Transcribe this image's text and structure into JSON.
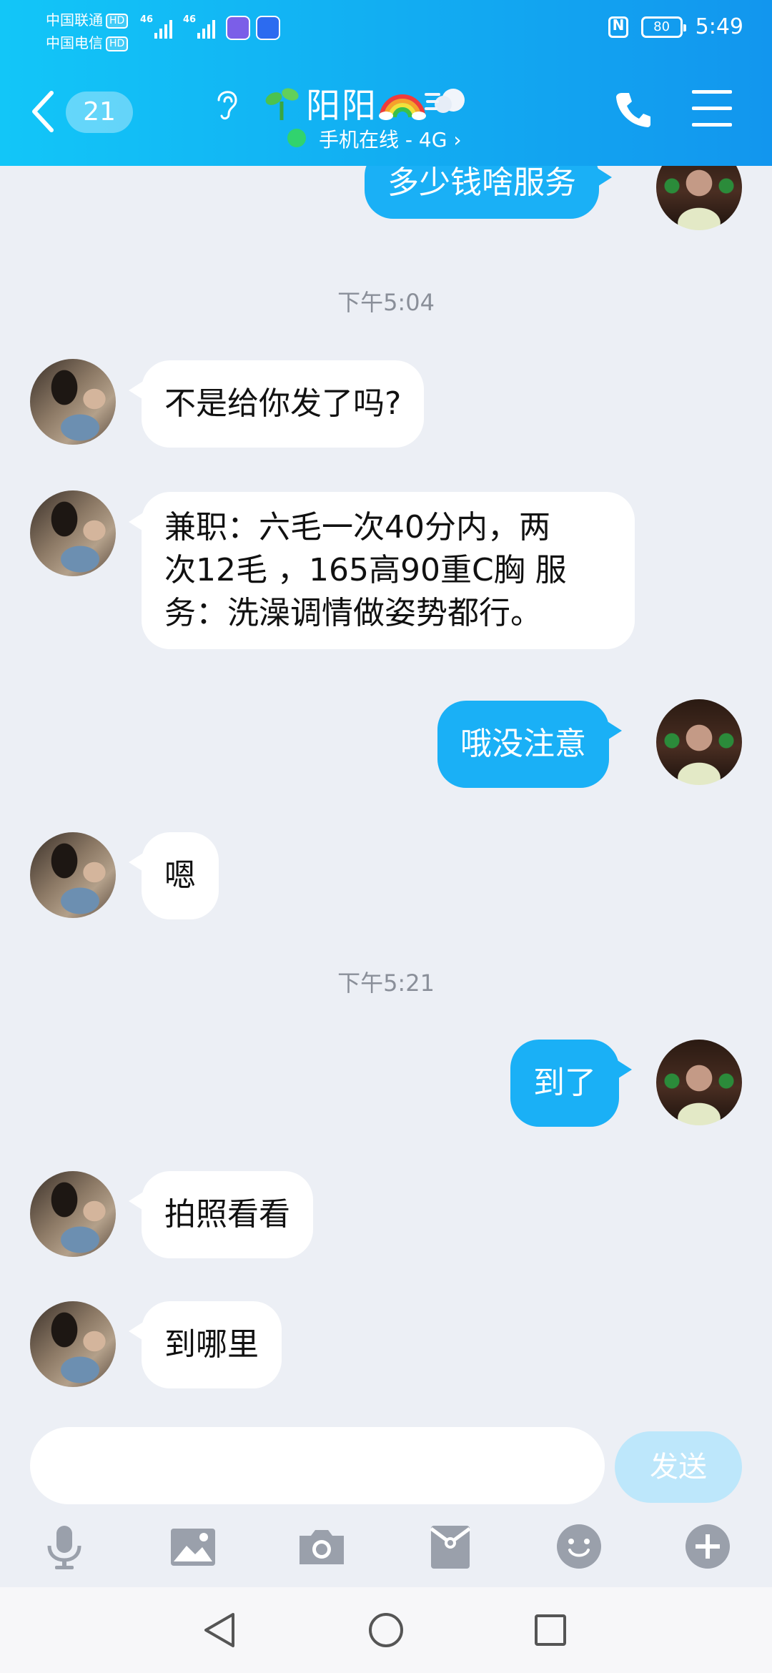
{
  "status_bar": {
    "carrier1": "中国联通",
    "carrier2": "中国电信",
    "hd": "HD",
    "network1": "46",
    "network2": "46",
    "battery": "80",
    "time": "5:49"
  },
  "header": {
    "unread_count": "21",
    "contact_name": "阳阳",
    "status": "手机在线 - 4G",
    "status_chevron": "›",
    "colors": {
      "gradient_start": "#12c6f8",
      "gradient_end": "#1296ee",
      "online_dot": "#31d36e"
    }
  },
  "messages": [
    {
      "type": "out",
      "text": "多少钱啥服务"
    },
    {
      "type": "time",
      "text": "下午5:04"
    },
    {
      "type": "in",
      "text": "不是给你发了吗?"
    },
    {
      "type": "in",
      "lines": [
        "兼职：六毛一次40分内，两",
        "次12毛 ，165高90重C胸 服",
        "务：洗澡调情做姿势都行。"
      ]
    },
    {
      "type": "out",
      "text": "哦没注意"
    },
    {
      "type": "in",
      "text": "嗯"
    },
    {
      "type": "time",
      "text": "下午5:21"
    },
    {
      "type": "out",
      "text": "到了"
    },
    {
      "type": "in",
      "text": "拍照看看"
    },
    {
      "type": "in",
      "text": "到哪里"
    }
  ],
  "input": {
    "value": "",
    "placeholder": "",
    "send_label": "发送",
    "tools": [
      "microphone-icon",
      "image-icon",
      "camera-icon",
      "red-packet-icon",
      "emoji-icon",
      "plus-icon"
    ]
  },
  "colors": {
    "outgoing_bubble": "#1ab0f6",
    "incoming_bubble": "#ffffff",
    "chat_background": "#eceff5",
    "send_disabled": "#bde7fb"
  }
}
